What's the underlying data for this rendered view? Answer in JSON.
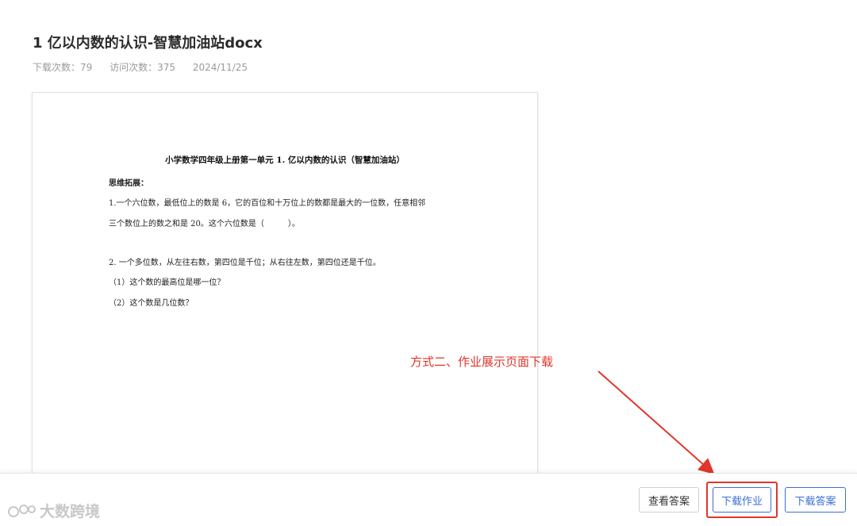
{
  "header": {
    "title": "1 亿以内数的认识-智慧加油站docx",
    "downloads": "下载次数：79",
    "visits": "访问次数：375",
    "date": "2024/11/25"
  },
  "document": {
    "heading": "小学数学四年级上册第一单元 1. 亿以内数的认识（智慧加油站）",
    "section": "思维拓展：",
    "lines": [
      "1.一个六位数，最低位上的数是 6，它的百位和十万位上的数都是最大的一位数，任意相邻",
      "三个数位上的数之和是 20。这个六位数是（　　　）。",
      "2. 一个多位数，从左往右数，第四位是千位；从右往左数，第四位还是千位。",
      "（1）这个数的最高位是哪一位？",
      "（2）这个数是几位数？"
    ]
  },
  "annotation": {
    "text": "方式二、作业展示页面下载",
    "color": "#e0362b"
  },
  "actions": {
    "view_answer": "查看答案",
    "download_homework": "下载作业",
    "download_answer": "下载答案"
  },
  "watermark": {
    "text": "大数跨境"
  }
}
